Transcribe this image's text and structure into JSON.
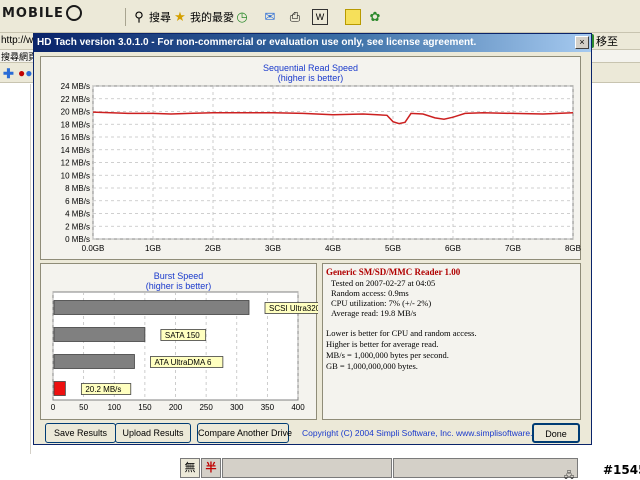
{
  "browser": {
    "logo_text": "MOBILE",
    "search_label": "搜尋",
    "favorites_label": "我的最愛",
    "go_label": "移至",
    "address_prefix": "http://ww",
    "links_text": "搜尋網頁"
  },
  "window": {
    "title": "HD Tach version 3.0.1.0  - For non-commercial or evaluation use only, see license agreement.",
    "close_glyph": "×"
  },
  "sequential": {
    "title": "Sequential Read Speed",
    "subtitle": "(higher is better)"
  },
  "burst": {
    "title": "Burst Speed",
    "subtitle": "(higher is better)"
  },
  "info": {
    "device": "Generic SM/SD/MMC Reader 1.00",
    "lines": [
      "Tested on 2007-02-27 at 04:05",
      "Random access: 0.9ms",
      "CPU utilization: 7% (+/- 2%)",
      "Average read: 19.8 MB/s"
    ],
    "notes": [
      "Lower is better for CPU and random access.",
      "Higher is better for average read.",
      "MB/s = 1,000,000 bytes per second.",
      "GB = 1,000,000,000 bytes."
    ]
  },
  "buttons": {
    "save": "Save Results",
    "upload": "Upload Results",
    "compare": "Compare Another Drive",
    "done": "Done"
  },
  "copyright": "Copyright (C) 2004 Simpli Software, Inc. www.simplisoftware.com",
  "ime": {
    "wu": "無",
    "ban": "半"
  },
  "watermark": "#1545",
  "chart_data": [
    {
      "type": "line",
      "title": "Sequential Read Speed",
      "subtitle": "(higher is better)",
      "x_ticks": [
        "0.0GB",
        "1GB",
        "2GB",
        "3GB",
        "4GB",
        "5GB",
        "6GB",
        "7GB",
        "8GB"
      ],
      "y_ticks": [
        "0 MB/s",
        "2 MB/s",
        "4 MB/s",
        "6 MB/s",
        "8 MB/s",
        "10 MB/s",
        "12 MB/s",
        "14 MB/s",
        "16 MB/s",
        "18 MB/s",
        "20 MB/s",
        "22 MB/s",
        "24 MB/s"
      ],
      "xlim": [
        0,
        8
      ],
      "ylim": [
        0,
        24
      ],
      "series": [
        {
          "color": "#cc2020",
          "x": [
            0,
            0.3,
            0.6,
            1.0,
            1.3,
            1.6,
            2.0,
            2.5,
            3.0,
            3.5,
            4.0,
            4.5,
            4.9,
            5.0,
            5.1,
            5.2,
            5.3,
            5.5,
            5.7,
            5.85,
            6.0,
            6.2,
            6.5,
            7.0,
            7.5,
            8.0
          ],
          "y": [
            19.9,
            19.8,
            19.7,
            19.7,
            19.6,
            19.7,
            19.8,
            19.8,
            19.8,
            19.7,
            19.5,
            19.6,
            19.4,
            18.4,
            18.1,
            18.3,
            19.7,
            19.6,
            19.0,
            18.8,
            19.1,
            19.7,
            19.8,
            19.7,
            19.6,
            19.8
          ]
        }
      ]
    },
    {
      "type": "bar",
      "title": "Burst Speed",
      "subtitle": "(higher is better)",
      "orientation": "horizontal",
      "x_ticks": [
        "0",
        "50",
        "100",
        "150",
        "200",
        "250",
        "300",
        "350",
        "400"
      ],
      "xlim": [
        0,
        400
      ],
      "series": [
        {
          "name": "SCSI Ultra320",
          "value": 320,
          "color": "#808080"
        },
        {
          "name": "SATA 150",
          "value": 150,
          "color": "#808080"
        },
        {
          "name": "ATA UltraDMA 6",
          "value": 133,
          "color": "#808080"
        },
        {
          "name": "20.2 MB/s",
          "value": 20.2,
          "color": "#ee1010"
        }
      ]
    }
  ]
}
